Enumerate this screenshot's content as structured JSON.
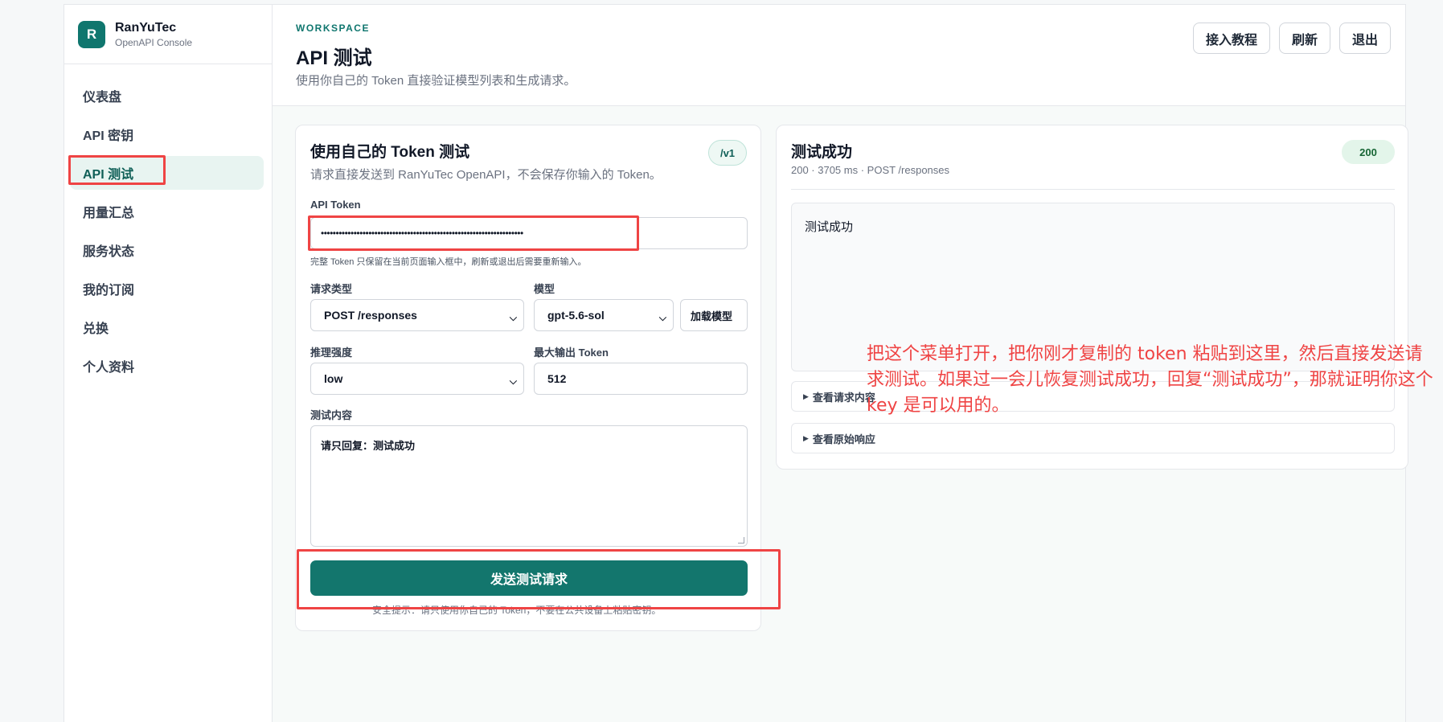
{
  "brand": {
    "logo_letter": "R",
    "name": "RanYuTec",
    "subtitle": "OpenAPI Console"
  },
  "sidebar": {
    "items": [
      {
        "label": "仪表盘"
      },
      {
        "label": "API 密钥"
      },
      {
        "label": "API 测试",
        "active": true
      },
      {
        "label": "用量汇总"
      },
      {
        "label": "服务状态"
      },
      {
        "label": "我的订阅"
      },
      {
        "label": "兑换"
      },
      {
        "label": "个人资料"
      }
    ]
  },
  "header": {
    "eyebrow": "WORKSPACE",
    "title": "API 测试",
    "subtitle": "使用你自己的 Token 直接验证模型列表和生成请求。",
    "actions": {
      "tutorial": "接入教程",
      "refresh": "刷新",
      "logout": "退出"
    }
  },
  "test_form": {
    "title": "使用自己的 Token 测试",
    "subtitle": "请求直接发送到 RanYuTec OpenAPI，不会保存你输入的 Token。",
    "version_badge": "/v1",
    "token": {
      "label": "API Token",
      "value": "••••••••••••••••••••••••••••••••••••••••••••••••••••••••••••••••••••",
      "hint": "完整 Token 只保留在当前页面输入框中，刷新或退出后需要重新输入。"
    },
    "request_type": {
      "label": "请求类型",
      "value": "POST /responses"
    },
    "model": {
      "label": "模型",
      "value": "gpt-5.6-sol",
      "load_button": "加载模型"
    },
    "reasoning": {
      "label": "推理强度",
      "value": "low"
    },
    "max_tokens": {
      "label": "最大输出 Token",
      "value": "512"
    },
    "content": {
      "label": "测试内容",
      "value": "请只回复：测试成功"
    },
    "submit": "发送测试请求",
    "footnote": "安全提示：请只使用你自己的 Token，不要在公共设备上粘贴密钥。"
  },
  "result": {
    "title": "测试成功",
    "status_code": "200",
    "meta": "200 · 3705 ms · POST /responses",
    "output": "测试成功",
    "request_details": "查看请求内容",
    "raw_response": "查看原始响应"
  },
  "annotation": {
    "text": "把这个菜单打开，把你刚才复制的 token 粘贴到这里，然后直接发送请求测试。如果过一会儿恢复测试成功，回复“测试成功”，那就证明你这个 key 是可以用的。",
    "color": "#ef4444"
  },
  "colors": {
    "accent": "#0f766e",
    "primary_button": "#13766d",
    "highlight": "#ef4444"
  }
}
